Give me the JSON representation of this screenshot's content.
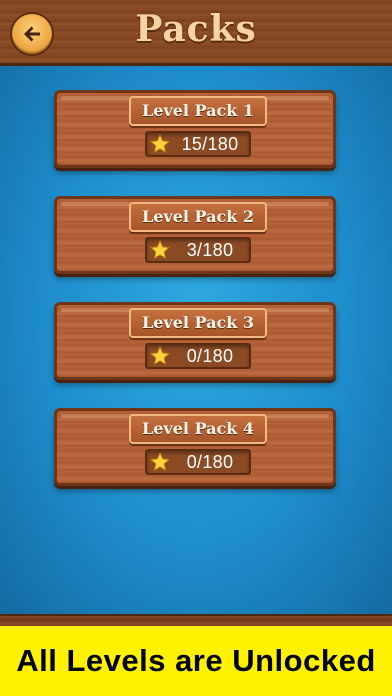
{
  "header": {
    "title": "Packs",
    "back_icon": "back-arrow-icon"
  },
  "packs": [
    {
      "name": "Level Pack 1",
      "progress": "15/180",
      "icon": "star-icon"
    },
    {
      "name": "Level Pack 2",
      "progress": "3/180",
      "icon": "star-icon"
    },
    {
      "name": "Level Pack 3",
      "progress": "0/180",
      "icon": "star-icon"
    },
    {
      "name": "Level Pack 4",
      "progress": "0/180",
      "icon": "star-icon"
    }
  ],
  "banner": {
    "text": "All Levels are Unlocked"
  },
  "colors": {
    "background": "#1e8dcc",
    "wood": "#b8643a",
    "banner": "#fff200",
    "title": "#f6d4a4"
  }
}
